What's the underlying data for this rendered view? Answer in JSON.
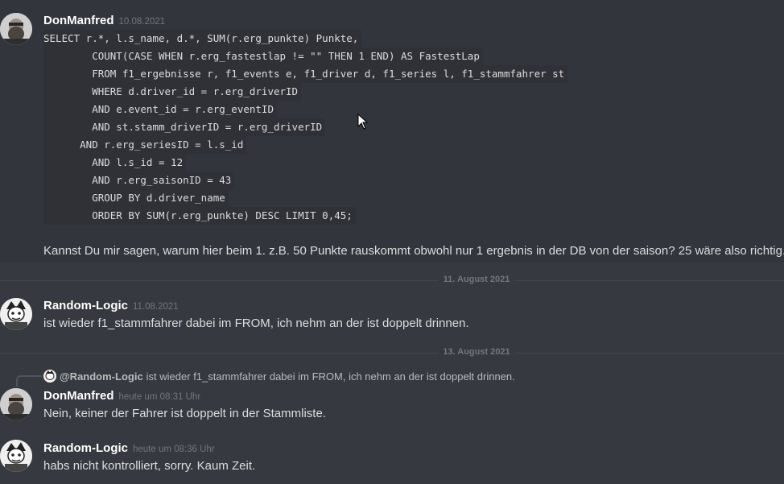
{
  "messages": [
    {
      "author": "DonManfred",
      "timestamp": "10.08.2021",
      "code_lines": [
        "SELECT r.*, l.s_name, d.*, SUM(r.erg_punkte) Punkte,",
        "        COUNT(CASE WHEN r.erg_fastestlap != \"\" THEN 1 END) AS FastestLap",
        "        FROM f1_ergebnisse r, f1_events e, f1_driver d, f1_series l, f1_stammfahrer st",
        "        WHERE d.driver_id = r.erg_driverID",
        "        AND e.event_id = r.erg_eventID",
        "        AND st.stamm_driverID = r.erg_driverID",
        "      AND r.erg_seriesID = l.s_id",
        "        AND l.s_id = 12",
        "        AND r.erg_saisonID = 43",
        "        GROUP BY d.driver_name",
        "        ORDER BY SUM(r.erg_punkte) DESC LIMIT 0,45;"
      ],
      "text": "Kannst Du mir sagen, warum hier beim 1. z.B. 50 Punkte rauskommt obwohl nur 1 ergebnis in der DB von der saison? 25 wäre also richtig."
    },
    {
      "author": "Random-Logic",
      "timestamp": "11.08.2021",
      "text": "ist wieder f1_stammfahrer dabei im FROM, ich nehm an der ist doppelt drinnen."
    },
    {
      "author": "DonManfred",
      "timestamp": "heute um 08:31 Uhr",
      "reply": {
        "author": "@Random-Logic",
        "text": "ist wieder f1_stammfahrer dabei im FROM, ich nehm an der ist doppelt drinnen."
      },
      "text": "Nein, keiner der Fahrer ist doppelt in der Stammliste."
    },
    {
      "author": "Random-Logic",
      "timestamp": "heute um 08:36 Uhr",
      "text": "habs nicht kontrolliert, sorry. Kaum Zeit."
    }
  ],
  "dividers": [
    {
      "label": "11. August 2021"
    },
    {
      "label": "13. August 2021"
    }
  ],
  "icons": {
    "avatar_donmanfred": "bearded-man-avatar",
    "avatar_randomlogic": "cartoon-character-avatar",
    "cursor": "mouse-pointer-icon"
  },
  "colors": {
    "background": "#36393f",
    "code_background": "#2f3136",
    "username": "#ffffff",
    "timestamp": "#72767d",
    "text": "#dcddde"
  }
}
